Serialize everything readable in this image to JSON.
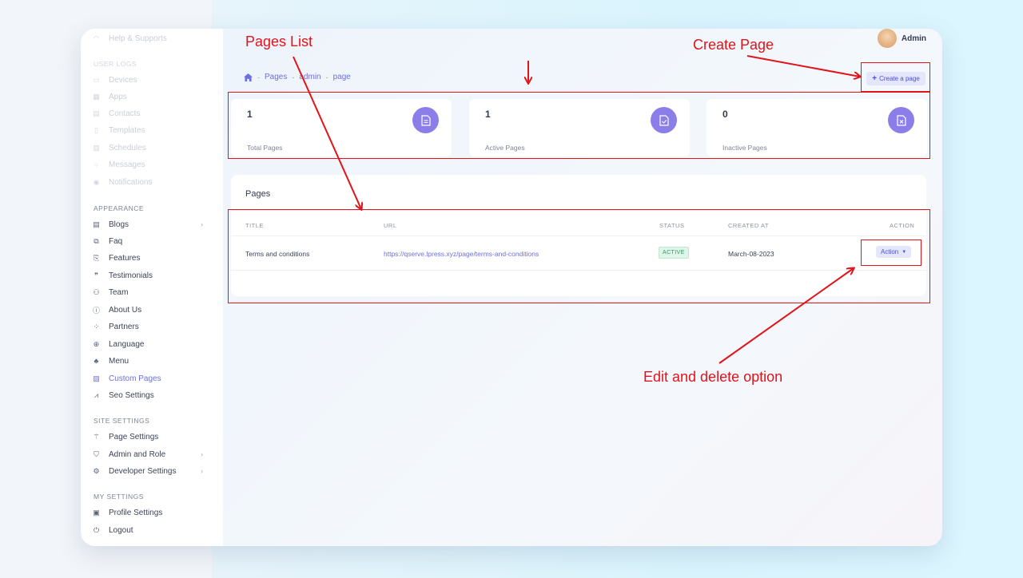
{
  "sidebar": {
    "top_item": "Help & Supports",
    "user_logs_label": "USER LOGS",
    "user_logs_items": [
      "Devices",
      "Apps",
      "Contacts",
      "Templates",
      "Schedules",
      "Messages",
      "Notifications"
    ],
    "appearance_label": "APPEARANCE",
    "appearance_items": [
      "Blogs",
      "Faq",
      "Features",
      "Testimonials",
      "Team",
      "About Us",
      "Partners",
      "Language",
      "Menu",
      "Custom Pages",
      "Seo Settings"
    ],
    "site_settings_label": "SITE SETTINGS",
    "site_settings_items": [
      "Page Settings",
      "Admin and Role",
      "Developer Settings"
    ],
    "my_settings_label": "MY SETTINGS",
    "my_settings_items": [
      "Profile Settings",
      "Logout"
    ]
  },
  "header": {
    "user_name": "Admin"
  },
  "breadcrumb": [
    "Pages",
    "admin",
    "page"
  ],
  "create_button": "Create a page",
  "stats": [
    {
      "value": "1",
      "label": "Total Pages"
    },
    {
      "value": "1",
      "label": "Active Pages"
    },
    {
      "value": "0",
      "label": "Inactive Pages"
    }
  ],
  "pages_table": {
    "title": "Pages",
    "columns": [
      "TITLE",
      "URL",
      "STATUS",
      "CREATED AT",
      "ACTION"
    ],
    "rows": [
      {
        "title": "Terms and conditions",
        "url": "https://qserve.lpress.xyz/page/terms-and-conditions",
        "status": "ACTIVE",
        "created_at": "March-08-2023",
        "action": "Action"
      }
    ]
  },
  "annotations": {
    "pages_list": "Pages List",
    "create_page": "Create Page",
    "edit_delete": "Edit and delete option",
    "color": "#e0141a"
  },
  "colors": {
    "accent": "#6c6fe0",
    "stat_icon": "#8b7ee8",
    "active_badge": "#2e9b63"
  }
}
